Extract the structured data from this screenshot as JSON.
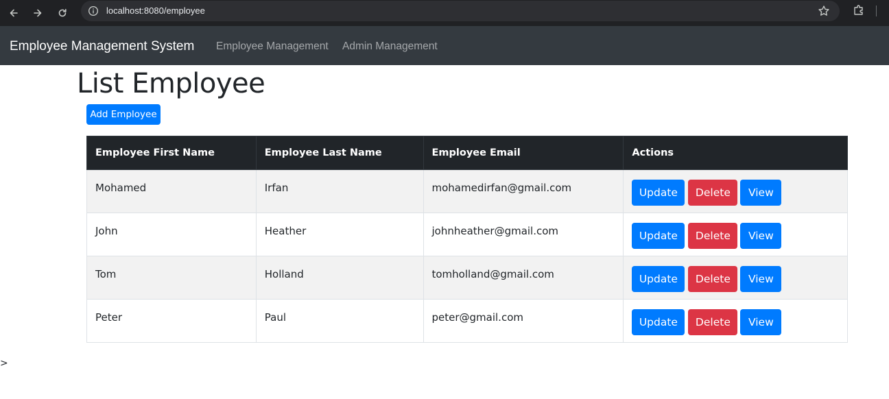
{
  "browser": {
    "url": "localhost:8080/employee"
  },
  "navbar": {
    "brand": "Employee Management System",
    "links": [
      {
        "label": "Employee Management"
      },
      {
        "label": "Admin Management"
      }
    ]
  },
  "page": {
    "title": "List Employee",
    "add_button_label": "Add Employee"
  },
  "table": {
    "headers": [
      "Employee First Name",
      "Employee Last Name",
      "Employee Email",
      "Actions"
    ],
    "rows": [
      {
        "first_name": "Mohamed",
        "last_name": "Irfan",
        "email": "mohamedirfan@gmail.com"
      },
      {
        "first_name": "John",
        "last_name": "Heather",
        "email": "johnheather@gmail.com"
      },
      {
        "first_name": "Tom",
        "last_name": "Holland",
        "email": "tomholland@gmail.com"
      },
      {
        "first_name": "Peter",
        "last_name": "Paul",
        "email": "peter@gmail.com"
      }
    ],
    "actions": {
      "update_label": "Update",
      "delete_label": "Delete",
      "view_label": "View"
    }
  },
  "footer_text": ">",
  "colors": {
    "primary": "#007bff",
    "danger": "#dc3545",
    "navbar_bg": "#343a40",
    "table_head_bg": "#212529"
  }
}
